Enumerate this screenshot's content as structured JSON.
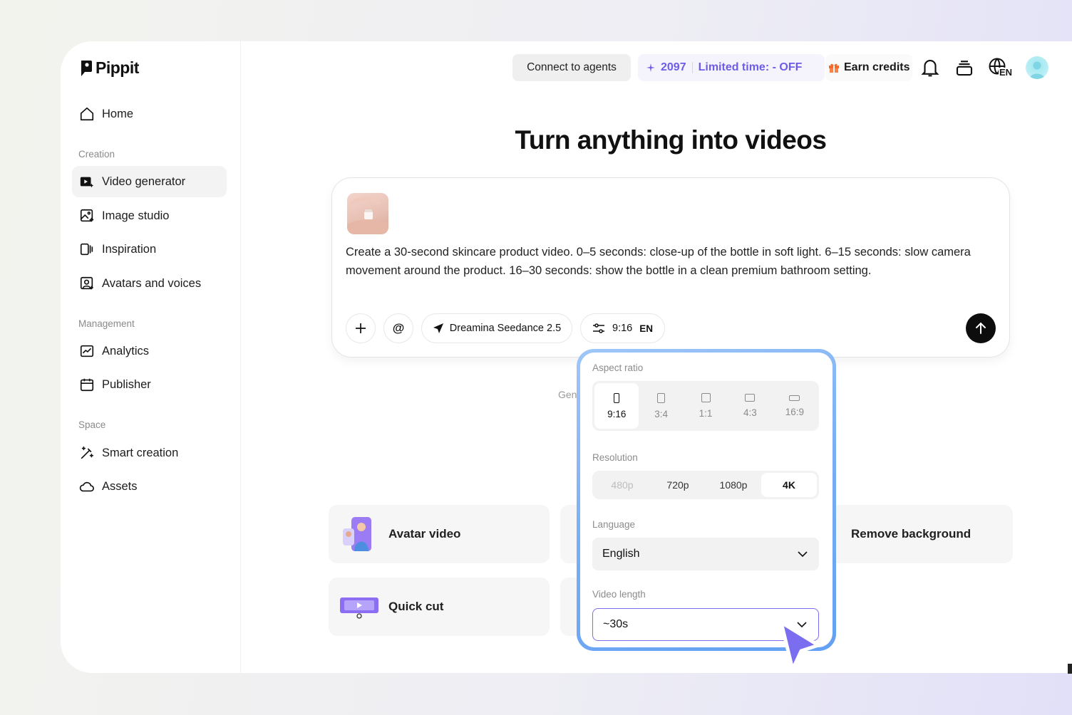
{
  "app": {
    "name": "Pippit"
  },
  "sidebar": {
    "home": "Home",
    "sections": {
      "creation": "Creation",
      "management": "Management",
      "space": "Space"
    },
    "creation_items": [
      "Video generator",
      "Image studio",
      "Inspiration",
      "Avatars and voices"
    ],
    "management_items": [
      "Analytics",
      "Publisher"
    ],
    "space_items": [
      "Smart creation",
      "Assets"
    ],
    "active_item": "Video generator"
  },
  "topbar": {
    "connect_label": "Connect to agents",
    "credits": "2097",
    "promo": "Limited time: - OFF",
    "earn_label": "Earn credits",
    "language_badge": "EN"
  },
  "main": {
    "title": "Turn anything into videos",
    "prompt": "Create a 30-second skincare product video. 0–5 seconds: close-up of the bottle in soft light. 6–15 seconds: slow camera movement around the product. 16–30 seconds: show the bottle in a clean premium bathroom setting.",
    "toolbar": {
      "model": "Dreamina Seedance 2.5",
      "ratio": "9:16",
      "lang": "EN"
    },
    "gen_hint": "Gene"
  },
  "features": [
    {
      "name": "Avatar video"
    },
    {
      "name": "Remove background"
    },
    {
      "name": "Quick cut"
    }
  ],
  "popover": {
    "aspect_label": "Aspect ratio",
    "ratios": [
      "9:16",
      "3:4",
      "1:1",
      "4:3",
      "16:9"
    ],
    "selected_ratio": "9:16",
    "resolution_label": "Resolution",
    "resolutions": [
      "480p",
      "720p",
      "1080p",
      "4K"
    ],
    "selected_resolution": "4K",
    "language_label": "Language",
    "language_value": "English",
    "length_label": "Video length",
    "length_value": "~30s"
  },
  "colors": {
    "accent": "#6d5ce8",
    "popover_border": "#78aef5",
    "cursor": "#7b6df0"
  }
}
